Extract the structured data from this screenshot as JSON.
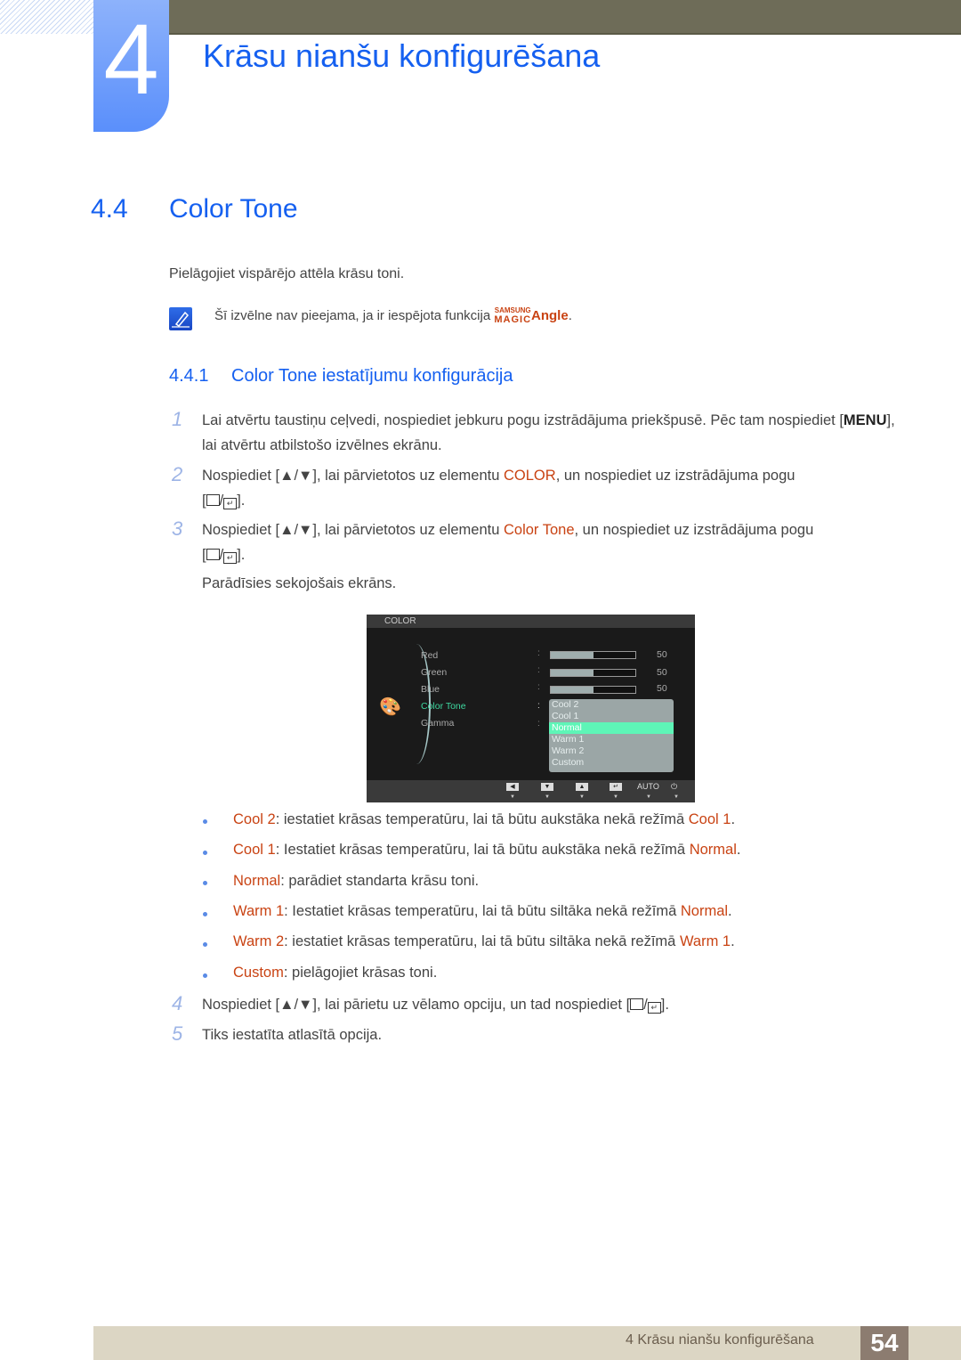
{
  "chapter": {
    "number": "4",
    "title": "Krāsu nianšu konfigurēšana"
  },
  "section": {
    "number": "4.4",
    "title": "Color Tone"
  },
  "intro": "Pielāgojiet vispārējo attēla krāsu toni.",
  "note": {
    "icon": "note-pencil-icon",
    "text": "Šī izvēlne nav pieejama, ja ir iespējota funkcija ",
    "brand_small": "SAMSUNG",
    "brand_big": "MAGIC",
    "brand_suffix": "Angle",
    "end": "."
  },
  "subsection": {
    "number": "4.4.1",
    "title": "Color Tone iestatījumu konfigurācija"
  },
  "steps": [
    {
      "n": "1",
      "a": "Lai atvērtu taustiņu ceļvedi, nospiediet jebkuru pogu izstrādājuma priekšpusē. Pēc tam nospiediet [",
      "key": "MENU",
      "b": "], lai atvērtu atbilstošo izvēlnes ekrānu."
    },
    {
      "n": "2",
      "a": "Nospiediet [▲/▼], lai pārvietotos uz elementu ",
      "hl": "COLOR",
      "b": ", un nospiediet uz izstrādājuma pogu"
    },
    {
      "n": "3",
      "a": "Nospiediet [▲/▼], lai pārvietotos uz elementu ",
      "hl": "Color Tone",
      "b": ", un nospiediet uz izstrādājuma pogu",
      "after": "Parādīsies sekojošais ekrāns."
    },
    {
      "n": "4",
      "a": "Nospiediet [▲/▼], lai pārietu uz vēlamo opciju, un tad nospiediet [",
      "b": "]."
    },
    {
      "n": "5",
      "a": "Tiks iestatīta atlasītā opcija."
    }
  ],
  "osd": {
    "title": "COLOR",
    "items": [
      "Red",
      "Green",
      "Blue",
      "Color Tone",
      "Gamma"
    ],
    "selected_item": "Color Tone",
    "sliders": [
      {
        "name": "Red",
        "value": 50
      },
      {
        "name": "Green",
        "value": 50
      },
      {
        "name": "Blue",
        "value": 50
      }
    ],
    "options": [
      "Cool 2",
      "Cool 1",
      "Normal",
      "Warm 1",
      "Warm 2",
      "Custom"
    ],
    "selected_option": "Normal",
    "footer": {
      "auto": "AUTO"
    }
  },
  "bullets": [
    {
      "term": "Cool 2",
      "text": ": iestatiet krāsas temperatūru, lai tā būtu aukstāka nekā režīmā ",
      "ref": "Cool 1",
      "end": "."
    },
    {
      "term": "Cool 1",
      "text": ": Iestatiet krāsas temperatūru, lai tā būtu aukstāka nekā režīmā ",
      "ref": "Normal",
      "end": "."
    },
    {
      "term": "Normal",
      "text": ": parādiet standarta krāsu toni.",
      "ref": "",
      "end": ""
    },
    {
      "term": "Warm 1",
      "text": ": Iestatiet krāsas temperatūru, lai tā būtu siltāka nekā režīmā ",
      "ref": "Normal",
      "end": "."
    },
    {
      "term": "Warm 2",
      "text": ": iestatiet krāsas temperatūru, lai tā būtu siltāka nekā režīmā ",
      "ref": "Warm 1",
      "end": "."
    },
    {
      "term": "Custom",
      "text": ": pielāgojiet krāsas toni.",
      "ref": "",
      "end": ""
    }
  ],
  "footer": {
    "text": "4 Krāsu nianšu konfigurēšana",
    "page": "54"
  }
}
